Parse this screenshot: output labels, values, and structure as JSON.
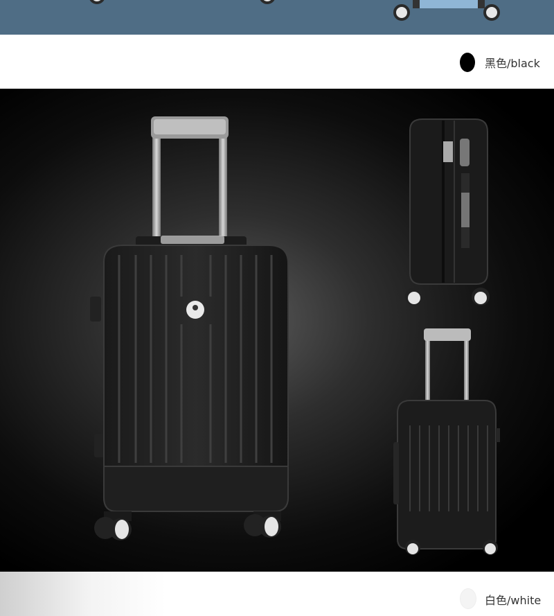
{
  "variants": [
    {
      "label": "黑色/black",
      "swatch_color": "#000000"
    },
    {
      "label": "白色/white",
      "swatch_color": "#f4f4f4"
    }
  ],
  "product_photo": {
    "icon": "black-suitcase-image",
    "background_color": "#000000"
  }
}
